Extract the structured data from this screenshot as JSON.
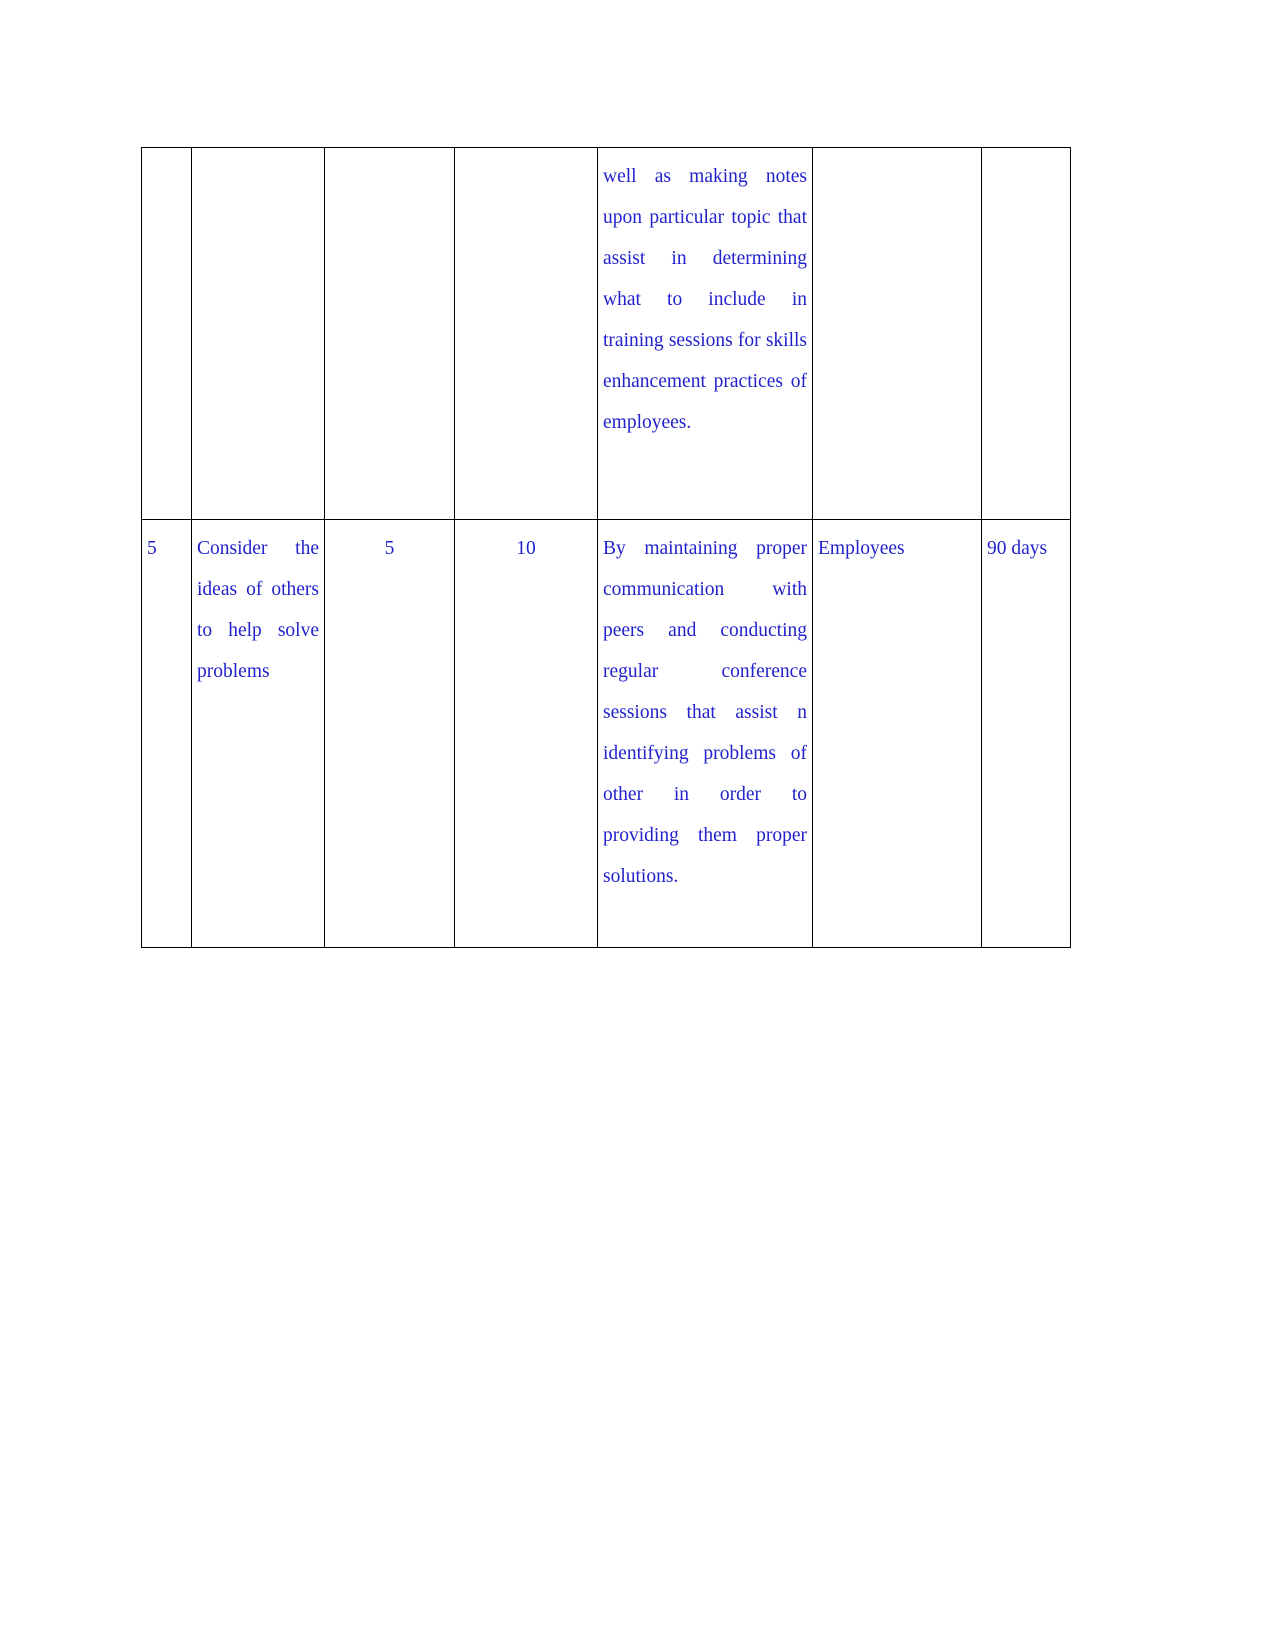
{
  "document": {
    "page_background": "#ffffff",
    "text_color": "#2222cc",
    "border_color": "#000000"
  },
  "table": {
    "columns": 7,
    "rows": [
      {
        "name": "continued-row",
        "type": "continuation",
        "cells": {
          "sr_no": "",
          "competency": "",
          "current_level": "",
          "target_level": "",
          "development_activity": "well as making notes upon particular topic that assist in determining what to include in training sessions for skills enhancement practices of employees.",
          "resources": "",
          "timeline": ""
        }
      },
      {
        "name": "row-5",
        "type": "data",
        "cells": {
          "sr_no": "5",
          "competency": "Consider the ideas of others to help solve problems",
          "current_level": "5",
          "target_level": "10",
          "development_activity": "By maintaining proper communication with peers and conducting regular conference sessions that assist n identifying problems of other in order to providing them proper solutions.",
          "resources": "Employees",
          "timeline": "90 days"
        }
      }
    ]
  }
}
